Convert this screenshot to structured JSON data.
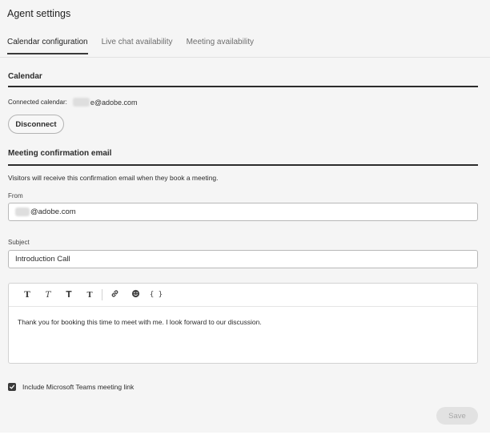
{
  "header": {
    "title": "Agent settings"
  },
  "tabs": [
    {
      "label": "Calendar configuration",
      "active": true
    },
    {
      "label": "Live chat availability",
      "active": false
    },
    {
      "label": "Meeting availability",
      "active": false
    }
  ],
  "calendar": {
    "section_title": "Calendar",
    "connected_label": "Connected calendar:",
    "connected_email": "e@adobe.com",
    "disconnect_label": "Disconnect"
  },
  "confirmation": {
    "section_title": "Meeting confirmation email",
    "description": "Visitors will receive this confirmation email when they book a meeting.",
    "from_label": "From",
    "from_value": "@adobe.com",
    "subject_label": "Subject",
    "subject_value": "Introduction Call",
    "toolbar": [
      "T",
      "T",
      "T",
      "T"
    ],
    "toolbar_icons": [
      "link-icon",
      "emoji-icon",
      "variable-icon"
    ],
    "variable_glyph": "{ }",
    "body_text": "Thank you for booking this time to meet with me. I look forward to our discussion.",
    "include_teams_label": "Include Microsoft Teams meeting link",
    "include_teams_checked": true
  },
  "footer": {
    "save_label": "Save"
  },
  "colors": {
    "panel_bg": "#f5f5f5",
    "rule_dark": "#2c2c2c",
    "save_disabled_bg": "#e2e2e2"
  }
}
